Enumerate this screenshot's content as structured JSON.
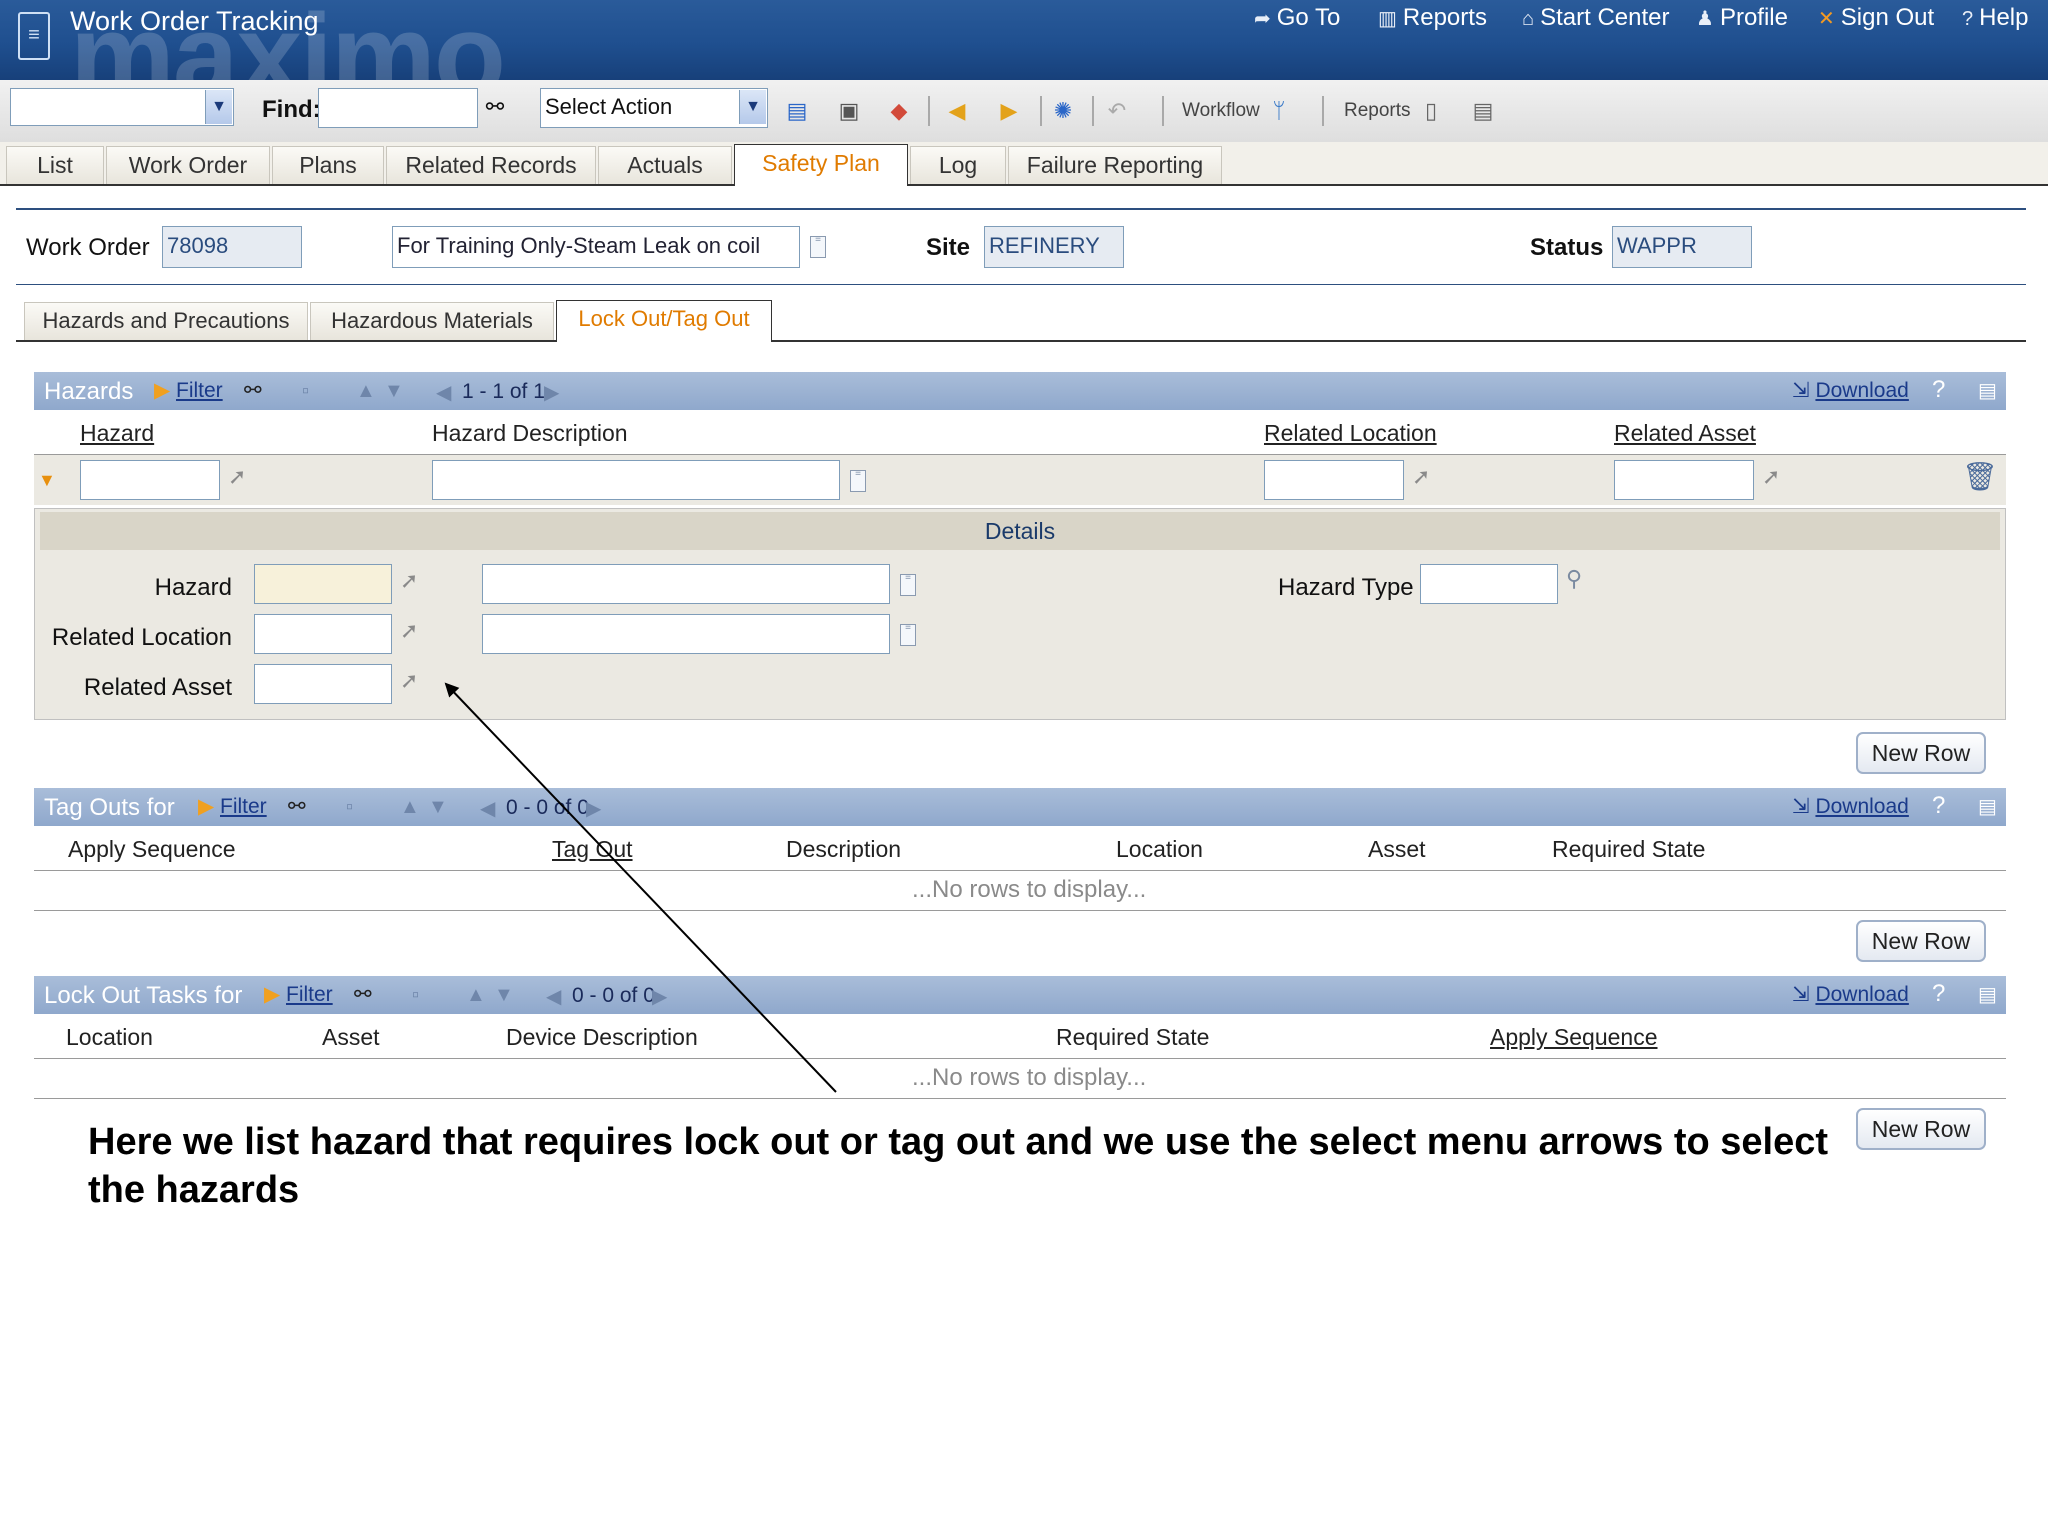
{
  "app": {
    "title": "Work Order Tracking",
    "watermark": "maximo"
  },
  "nav": {
    "goto": "Go To",
    "reports": "Reports",
    "start_center": "Start Center",
    "profile": "Profile",
    "sign_out": "Sign Out",
    "help": "Help"
  },
  "toolbar": {
    "find_label": "Find:",
    "find_value": "",
    "select_action": "Select Action",
    "workflow_label": "Workflow",
    "reports_label": "Reports"
  },
  "tabs": [
    "List",
    "Work Order",
    "Plans",
    "Related Records",
    "Actuals",
    "Safety Plan",
    "Log",
    "Failure Reporting"
  ],
  "active_tab": "Safety Plan",
  "header": {
    "work_order_label": "Work Order",
    "work_order_value": "78098",
    "description_value": "For Training Only-Steam Leak on coil",
    "site_label": "Site",
    "site_value": "REFINERY",
    "status_label": "Status",
    "status_value": "WAPPR"
  },
  "subtabs": [
    "Hazards and Precautions",
    "Hazardous Materials",
    "Lock Out/Tag Out"
  ],
  "active_subtab": "Lock Out/Tag Out",
  "hazards": {
    "title": "Hazards",
    "filter": "Filter",
    "pagination": "1 - 1 of 1",
    "download": "Download",
    "help": "?",
    "columns": [
      "Hazard",
      "Hazard Description",
      "Related Location",
      "Related Asset"
    ],
    "details_title": "Details",
    "details": {
      "hazard_label": "Hazard",
      "hazard_type_label": "Hazard Type",
      "related_location_label": "Related Location",
      "related_asset_label": "Related Asset"
    },
    "new_row": "New Row"
  },
  "tagouts": {
    "title": "Tag Outs for",
    "filter": "Filter",
    "pagination": "0 - 0 of 0",
    "download": "Download",
    "help": "?",
    "columns": [
      "Apply Sequence",
      "Tag Out",
      "Description",
      "Location",
      "Asset",
      "Required State"
    ],
    "no_rows": "...No rows to display...",
    "new_row": "New Row"
  },
  "lockout": {
    "title": "Lock Out Tasks for",
    "filter": "Filter",
    "pagination": "0 - 0 of 0",
    "download": "Download",
    "help": "?",
    "columns": [
      "Location",
      "Asset",
      "Device Description",
      "Required State",
      "Apply Sequence"
    ],
    "no_rows": "...No rows to display...",
    "new_row": "New Row"
  },
  "caption": "Here we list hazard that requires lock out or tag out and we use the select menu arrows to select the hazards",
  "colors": {
    "accent": "#e07b00",
    "titlebar": "#1f4f8f",
    "section_bar": "#9bb2d3"
  }
}
